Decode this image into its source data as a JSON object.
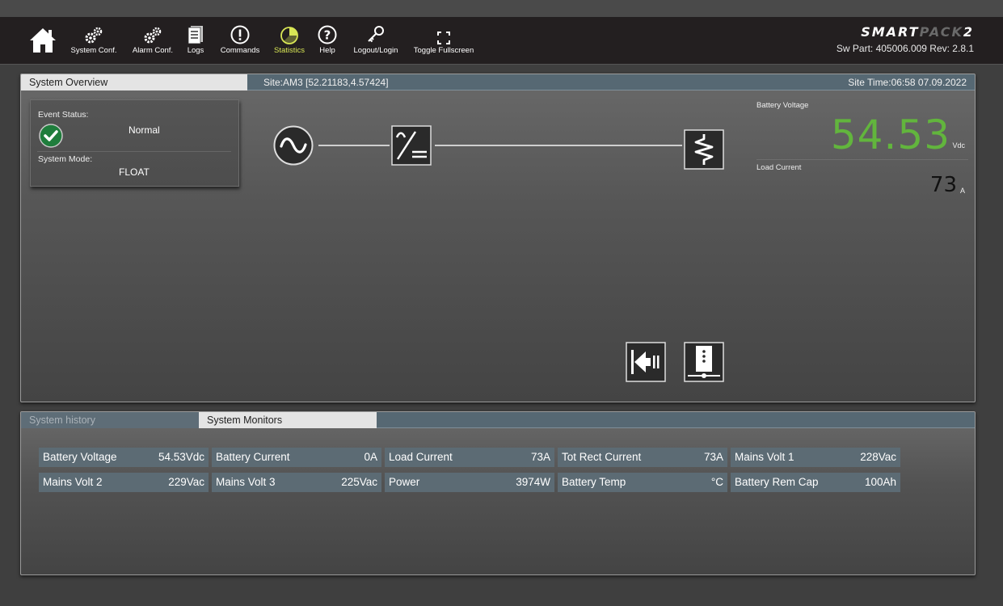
{
  "nav": {
    "items": [
      {
        "label": "System Conf.",
        "icon": "gears-icon"
      },
      {
        "label": "Alarm Conf.",
        "icon": "gears-icon"
      },
      {
        "label": "Logs",
        "icon": "logs-icon"
      },
      {
        "label": "Commands",
        "icon": "exclamation-icon"
      },
      {
        "label": "Statistics",
        "icon": "pie-chart-icon",
        "active": true
      },
      {
        "label": "Help",
        "icon": "question-icon"
      },
      {
        "label": "Logout/Login",
        "icon": "key-icon"
      },
      {
        "label": "Toggle Fullscreen",
        "icon": "fullscreen-icon"
      }
    ],
    "home_icon": "home-icon",
    "active_color": "#d8e655"
  },
  "brand": {
    "part1": "SMART",
    "part2": "PACK",
    "part3": "2"
  },
  "sw_part": "Sw Part: 405006.009 Rev: 2.8.1",
  "overview": {
    "tab": "System Overview",
    "site": "Site:AM3 [52.21183,4.57424]",
    "site_time": "Site Time:06:58 07.09.2022",
    "event_status_label": "Event Status:",
    "event_status": "Normal",
    "system_mode_label": "System Mode:",
    "system_mode": "FLOAT",
    "battery_voltage_label": "Battery Voltage",
    "battery_voltage": "54.53",
    "battery_voltage_unit": "Vdc",
    "load_current_label": "Load Current",
    "load_current": "73",
    "load_current_unit": "A",
    "accent_green": "#62b53d"
  },
  "bottom": {
    "tabs": [
      {
        "label": "System history",
        "active": false
      },
      {
        "label": "System Monitors",
        "active": true
      }
    ],
    "monitors": [
      [
        {
          "label": "Battery Voltage",
          "value": "54.53Vdc"
        },
        {
          "label": "Battery Current",
          "value": "0A"
        },
        {
          "label": "Load Current",
          "value": "73A"
        },
        {
          "label": "Tot Rect Current",
          "value": "73A"
        },
        {
          "label": "Mains Volt 1",
          "value": "228Vac"
        }
      ],
      [
        {
          "label": "Mains Volt 2",
          "value": "229Vac"
        },
        {
          "label": "Mains Volt 3",
          "value": "225Vac"
        },
        {
          "label": "Power",
          "value": "3974W"
        },
        {
          "label": "Battery Temp",
          "value": "°C"
        },
        {
          "label": "Battery Rem Cap",
          "value": "100Ah"
        }
      ]
    ]
  }
}
